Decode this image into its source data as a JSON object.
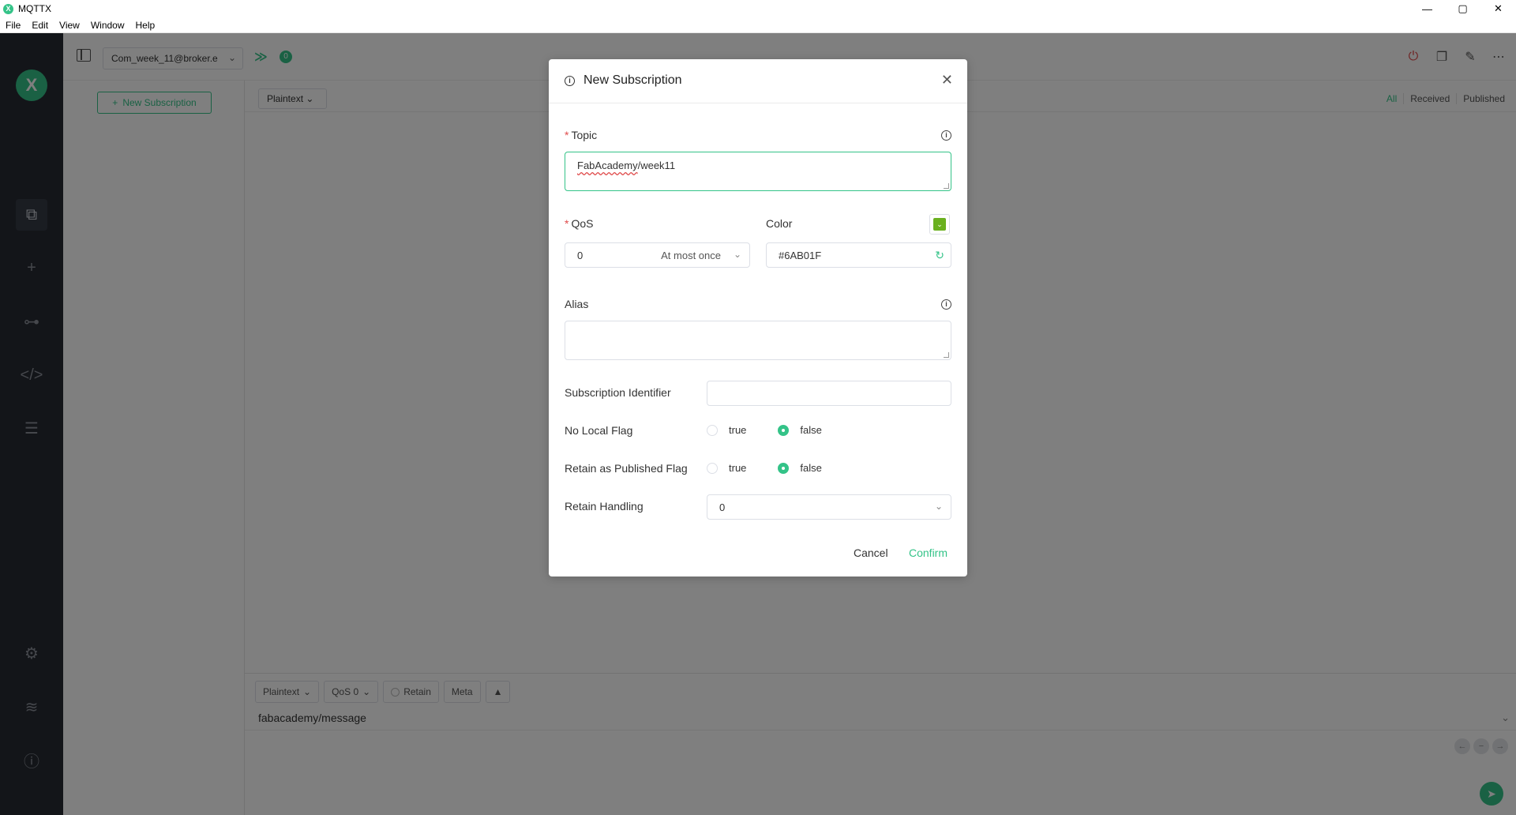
{
  "window": {
    "title": "MQTTX",
    "logo_letter": "X"
  },
  "window_controls": {
    "minimize": "—",
    "maximize": "▢",
    "close": "✕"
  },
  "menu": [
    "File",
    "Edit",
    "View",
    "Window",
    "Help"
  ],
  "topbar": {
    "connection": "Com_week_11@broker.e",
    "subscription_count": "0"
  },
  "subpanel": {
    "new_subscription_label": "New Subscription",
    "plus": "+"
  },
  "message_toolbar": {
    "payload_format": "Plaintext",
    "filter_tabs": [
      "All",
      "Received",
      "Published"
    ]
  },
  "publish": {
    "format": "Plaintext",
    "qos": "QoS 0",
    "retain": "Retain",
    "meta": "Meta",
    "topic": "fabacademy/message"
  },
  "dialog": {
    "title": "New Subscription",
    "topic_label": "Topic",
    "topic_value_part1": "FabAcademy",
    "topic_value_part2": "/week11",
    "qos_label": "QoS",
    "qos_value": "0",
    "qos_description": "At most once",
    "color_label": "Color",
    "color_value": "#6AB01F",
    "alias_label": "Alias",
    "alias_value": "",
    "subscription_identifier_label": "Subscription Identifier",
    "subscription_identifier_value": "",
    "no_local_flag_label": "No Local Flag",
    "no_local_flag": "false",
    "retain_as_published_label": "Retain as Published Flag",
    "retain_as_published": "false",
    "retain_handling_label": "Retain Handling",
    "retain_handling_value": "0",
    "true_label": "true",
    "false_label": "false",
    "cancel_label": "Cancel",
    "confirm_label": "Confirm"
  },
  "colors": {
    "accent": "#34c388",
    "nav_bg": "#262a32",
    "subscription_color": "#6AB01F",
    "danger": "#e04b4b"
  },
  "icons": {
    "nav": [
      "connections-icon",
      "add-icon",
      "topology-icon",
      "script-icon",
      "log-icon",
      "settings-icon",
      "feed-icon",
      "about-icon"
    ]
  }
}
